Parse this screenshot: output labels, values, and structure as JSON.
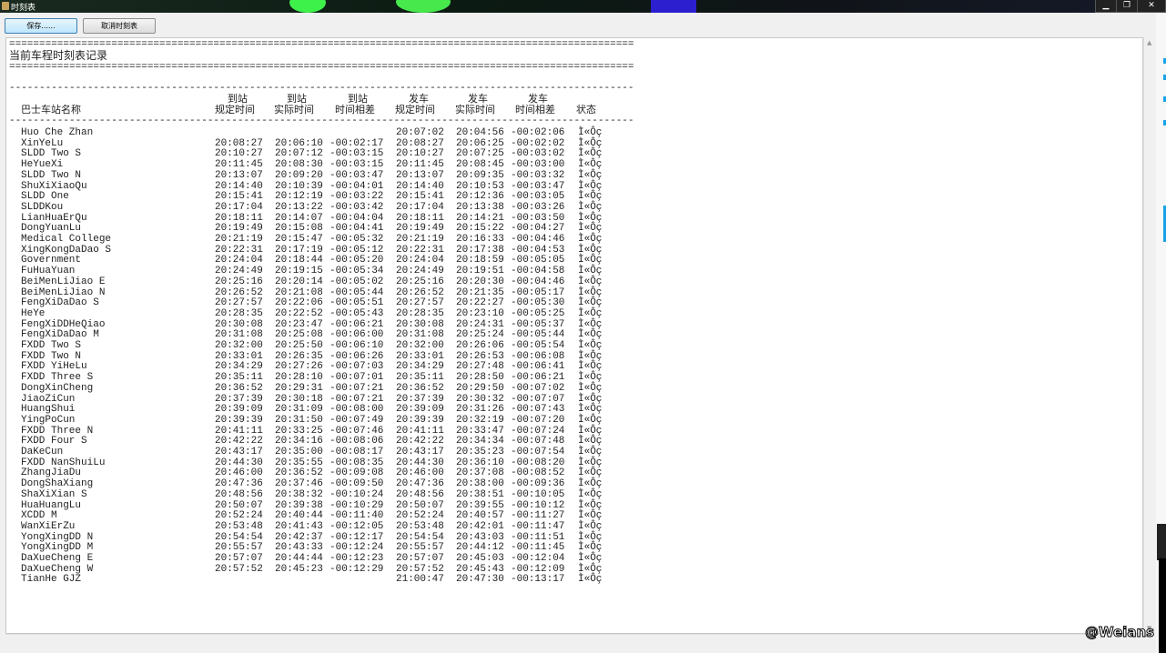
{
  "window": {
    "title": "时刻表",
    "minimize": "▁",
    "restore": "❐",
    "close": "✕"
  },
  "toolbar": {
    "save_label": "保存......",
    "cancel_label": "取消时刻表"
  },
  "report": {
    "eq_char": "=",
    "dash_char": "-",
    "title": "当前车程时刻表记录",
    "headers": {
      "name": "巴士车站名称",
      "arr_sched_top": "到站",
      "arr_sched_bottom": "规定时间",
      "arr_actual_top": "到站",
      "arr_actual_bottom": "实际时间",
      "arr_diff_top": "到站",
      "arr_diff_bottom": "时间相差",
      "dep_sched_top": "发车",
      "dep_sched_bottom": "规定时间",
      "dep_actual_top": "发车",
      "dep_actual_bottom": "实际时间",
      "dep_diff_top": "发车",
      "dep_diff_bottom": "时间相差",
      "status": "状态"
    },
    "rows": [
      [
        "Huo Che Zhan",
        "",
        "",
        "",
        "20:07:02",
        "20:04:56",
        "-00:02:06",
        "Ì«Ôç"
      ],
      [
        "XinYeLu",
        "20:08:27",
        "20:06:10",
        "-00:02:17",
        "20:08:27",
        "20:06:25",
        "-00:02:02",
        "Ì«Ôç"
      ],
      [
        "SLDD Two S",
        "20:10:27",
        "20:07:12",
        "-00:03:15",
        "20:10:27",
        "20:07:25",
        "-00:03:02",
        "Ì«Ôç"
      ],
      [
        "HeYueXi",
        "20:11:45",
        "20:08:30",
        "-00:03:15",
        "20:11:45",
        "20:08:45",
        "-00:03:00",
        "Ì«Ôç"
      ],
      [
        "SLDD Two N",
        "20:13:07",
        "20:09:20",
        "-00:03:47",
        "20:13:07",
        "20:09:35",
        "-00:03:32",
        "Ì«Ôç"
      ],
      [
        "ShuXiXiaoQu",
        "20:14:40",
        "20:10:39",
        "-00:04:01",
        "20:14:40",
        "20:10:53",
        "-00:03:47",
        "Ì«Ôç"
      ],
      [
        "SLDD One",
        "20:15:41",
        "20:12:19",
        "-00:03:22",
        "20:15:41",
        "20:12:36",
        "-00:03:05",
        "Ì«Ôç"
      ],
      [
        "SLDDKou",
        "20:17:04",
        "20:13:22",
        "-00:03:42",
        "20:17:04",
        "20:13:38",
        "-00:03:26",
        "Ì«Ôç"
      ],
      [
        "LianHuaErQu",
        "20:18:11",
        "20:14:07",
        "-00:04:04",
        "20:18:11",
        "20:14:21",
        "-00:03:50",
        "Ì«Ôç"
      ],
      [
        "DongYuanLu",
        "20:19:49",
        "20:15:08",
        "-00:04:41",
        "20:19:49",
        "20:15:22",
        "-00:04:27",
        "Ì«Ôç"
      ],
      [
        "Medical College",
        "20:21:19",
        "20:15:47",
        "-00:05:32",
        "20:21:19",
        "20:16:33",
        "-00:04:46",
        "Ì«Ôç"
      ],
      [
        "XingKongDaDao S",
        "20:22:31",
        "20:17:19",
        "-00:05:12",
        "20:22:31",
        "20:17:38",
        "-00:04:53",
        "Ì«Ôç"
      ],
      [
        "Government",
        "20:24:04",
        "20:18:44",
        "-00:05:20",
        "20:24:04",
        "20:18:59",
        "-00:05:05",
        "Ì«Ôç"
      ],
      [
        "FuHuaYuan",
        "20:24:49",
        "20:19:15",
        "-00:05:34",
        "20:24:49",
        "20:19:51",
        "-00:04:58",
        "Ì«Ôç"
      ],
      [
        "BeiMenLiJiao E",
        "20:25:16",
        "20:20:14",
        "-00:05:02",
        "20:25:16",
        "20:20:30",
        "-00:04:46",
        "Ì«Ôç"
      ],
      [
        "BeiMenLiJiao N",
        "20:26:52",
        "20:21:08",
        "-00:05:44",
        "20:26:52",
        "20:21:35",
        "-00:05:17",
        "Ì«Ôç"
      ],
      [
        "FengXiDaDao S",
        "20:27:57",
        "20:22:06",
        "-00:05:51",
        "20:27:57",
        "20:22:27",
        "-00:05:30",
        "Ì«Ôç"
      ],
      [
        "HeYe",
        "20:28:35",
        "20:22:52",
        "-00:05:43",
        "20:28:35",
        "20:23:10",
        "-00:05:25",
        "Ì«Ôç"
      ],
      [
        "FengXiDDHeQiao",
        "20:30:08",
        "20:23:47",
        "-00:06:21",
        "20:30:08",
        "20:24:31",
        "-00:05:37",
        "Ì«Ôç"
      ],
      [
        "FengXiDaDao M",
        "20:31:08",
        "20:25:08",
        "-00:06:00",
        "20:31:08",
        "20:25:24",
        "-00:05:44",
        "Ì«Ôç"
      ],
      [
        "FXDD Two S",
        "20:32:00",
        "20:25:50",
        "-00:06:10",
        "20:32:00",
        "20:26:06",
        "-00:05:54",
        "Ì«Ôç"
      ],
      [
        "FXDD Two N",
        "20:33:01",
        "20:26:35",
        "-00:06:26",
        "20:33:01",
        "20:26:53",
        "-00:06:08",
        "Ì«Ôç"
      ],
      [
        "FXDD YiHeLu",
        "20:34:29",
        "20:27:26",
        "-00:07:03",
        "20:34:29",
        "20:27:48",
        "-00:06:41",
        "Ì«Ôç"
      ],
      [
        "FXDD Three S",
        "20:35:11",
        "20:28:10",
        "-00:07:01",
        "20:35:11",
        "20:28:50",
        "-00:06:21",
        "Ì«Ôç"
      ],
      [
        "DongXinCheng",
        "20:36:52",
        "20:29:31",
        "-00:07:21",
        "20:36:52",
        "20:29:50",
        "-00:07:02",
        "Ì«Ôç"
      ],
      [
        "JiaoZiCun",
        "20:37:39",
        "20:30:18",
        "-00:07:21",
        "20:37:39",
        "20:30:32",
        "-00:07:07",
        "Ì«Ôç"
      ],
      [
        "HuangShui",
        "20:39:09",
        "20:31:09",
        "-00:08:00",
        "20:39:09",
        "20:31:26",
        "-00:07:43",
        "Ì«Ôç"
      ],
      [
        "YingPoCun",
        "20:39:39",
        "20:31:50",
        "-00:07:49",
        "20:39:39",
        "20:32:19",
        "-00:07:20",
        "Ì«Ôç"
      ],
      [
        "FXDD Three N",
        "20:41:11",
        "20:33:25",
        "-00:07:46",
        "20:41:11",
        "20:33:47",
        "-00:07:24",
        "Ì«Ôç"
      ],
      [
        "FXDD Four S",
        "20:42:22",
        "20:34:16",
        "-00:08:06",
        "20:42:22",
        "20:34:34",
        "-00:07:48",
        "Ì«Ôç"
      ],
      [
        "DaKeCun",
        "20:43:17",
        "20:35:00",
        "-00:08:17",
        "20:43:17",
        "20:35:23",
        "-00:07:54",
        "Ì«Ôç"
      ],
      [
        "FXDD NanShuiLu",
        "20:44:30",
        "20:35:55",
        "-00:08:35",
        "20:44:30",
        "20:36:10",
        "-00:08:20",
        "Ì«Ôç"
      ],
      [
        "ZhangJiaDu",
        "20:46:00",
        "20:36:52",
        "-00:09:08",
        "20:46:00",
        "20:37:08",
        "-00:08:52",
        "Ì«Ôç"
      ],
      [
        "DongShaXiang",
        "20:47:36",
        "20:37:46",
        "-00:09:50",
        "20:47:36",
        "20:38:00",
        "-00:09:36",
        "Ì«Ôç"
      ],
      [
        "ShaXiXian S",
        "20:48:56",
        "20:38:32",
        "-00:10:24",
        "20:48:56",
        "20:38:51",
        "-00:10:05",
        "Ì«Ôç"
      ],
      [
        "HuaHuangLu",
        "20:50:07",
        "20:39:38",
        "-00:10:29",
        "20:50:07",
        "20:39:55",
        "-00:10:12",
        "Ì«Ôç"
      ],
      [
        "XCDD M",
        "20:52:24",
        "20:40:44",
        "-00:11:40",
        "20:52:24",
        "20:40:57",
        "-00:11:27",
        "Ì«Ôç"
      ],
      [
        "WanXiErZu",
        "20:53:48",
        "20:41:43",
        "-00:12:05",
        "20:53:48",
        "20:42:01",
        "-00:11:47",
        "Ì«Ôç"
      ],
      [
        "YongXingDD N",
        "20:54:54",
        "20:42:37",
        "-00:12:17",
        "20:54:54",
        "20:43:03",
        "-00:11:51",
        "Ì«Ôç"
      ],
      [
        "YongXingDD M",
        "20:55:57",
        "20:43:33",
        "-00:12:24",
        "20:55:57",
        "20:44:12",
        "-00:11:45",
        "Ì«Ôç"
      ],
      [
        "DaXueCheng E",
        "20:57:07",
        "20:44:44",
        "-00:12:23",
        "20:57:07",
        "20:45:03",
        "-00:12:04",
        "Ì«Ôç"
      ],
      [
        "DaXueCheng W",
        "20:57:52",
        "20:45:23",
        "-00:12:29",
        "20:57:52",
        "20:45:43",
        "-00:12:09",
        "Ì«Ôç"
      ],
      [
        "TianHe GJZ",
        "",
        "",
        "",
        "21:00:47",
        "20:47:30",
        "-00:13:17",
        "Ì«Ôç"
      ]
    ]
  },
  "scrollbar": {
    "up": "▲",
    "down": "▼"
  },
  "watermark": "@Weians"
}
